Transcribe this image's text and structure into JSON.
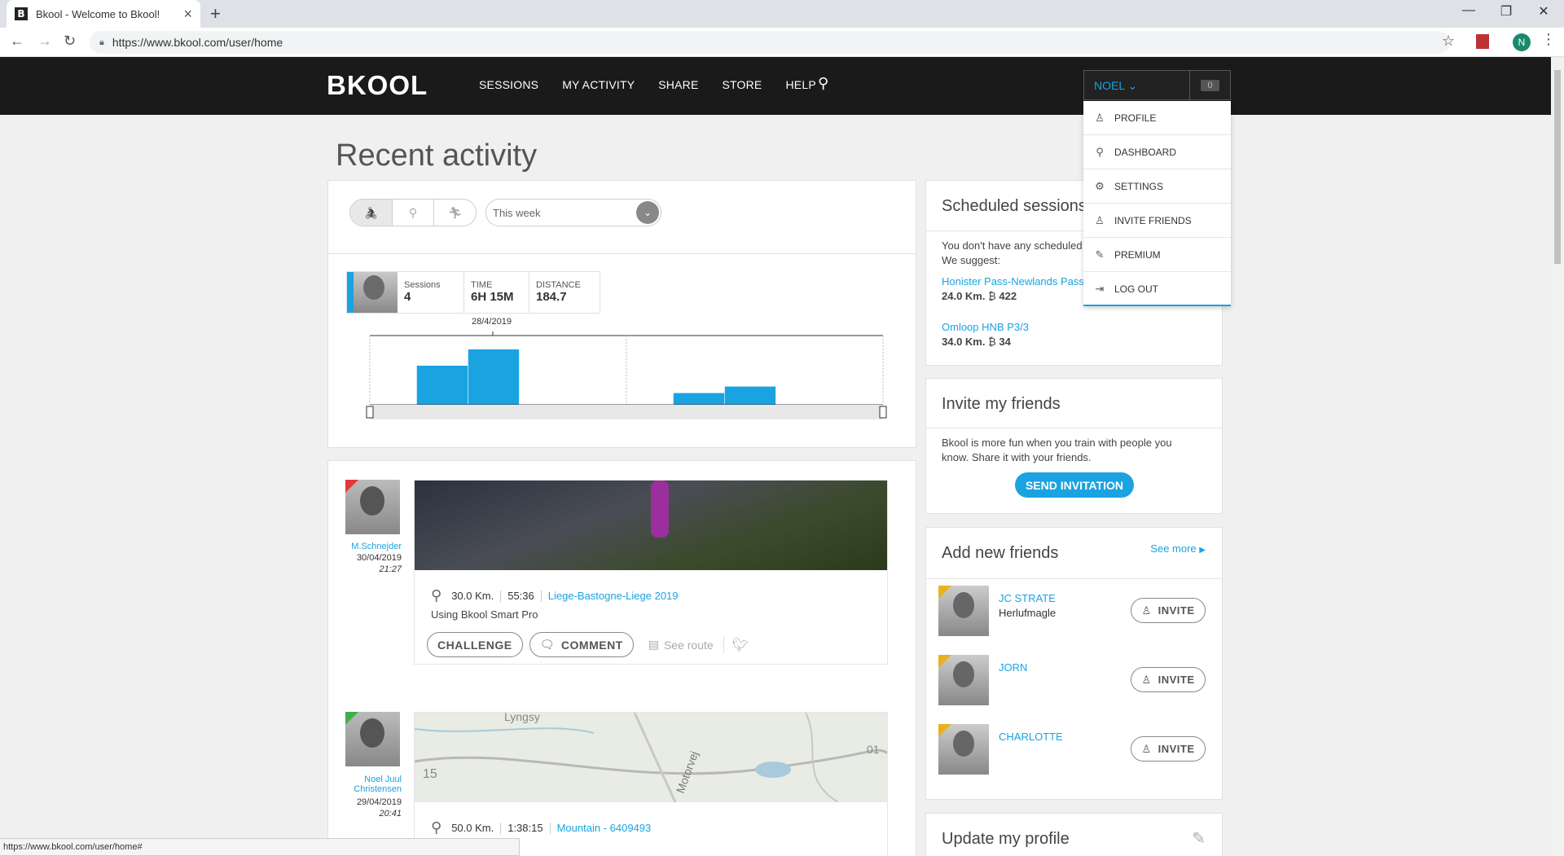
{
  "browser": {
    "tab_title": "Bkool - Welcome to Bkool!",
    "url": "https://www.bkool.com/user/home",
    "profile_initial": "N",
    "status_url": "https://www.bkool.com/user/home#"
  },
  "header": {
    "logo": "BKOOL",
    "nav": [
      "SESSIONS",
      "MY ACTIVITY",
      "SHARE",
      "STORE",
      "HELP"
    ],
    "user_name": "NOEL",
    "notifications": "0"
  },
  "user_menu": {
    "items": [
      {
        "label": "PROFILE",
        "icon": "person-icon"
      },
      {
        "label": "DASHBOARD",
        "icon": "bike-icon"
      },
      {
        "label": "SETTINGS",
        "icon": "gear-icon"
      },
      {
        "label": "INVITE FRIENDS",
        "icon": "add-person-icon"
      },
      {
        "label": "PREMIUM",
        "icon": "edit-icon"
      },
      {
        "label": "LOG OUT",
        "icon": "logout-icon"
      }
    ]
  },
  "activity": {
    "title": "Recent activity",
    "period": "This week",
    "stats": {
      "sessions_label": "Sessions",
      "sessions_value": "4",
      "time_label": "TIME",
      "time_value": "6H 15M",
      "distance_label": "DISTANCE",
      "distance_value": "184.7"
    },
    "chart_date": "28/4/2019"
  },
  "chart_data": {
    "type": "bar",
    "title": "",
    "annotations": [
      "28/4/2019"
    ],
    "values": [
      0,
      0.6,
      0.85,
      0,
      0,
      0,
      0.18,
      0.28,
      0
    ],
    "colors": {
      "bar": "#1aa3e0"
    }
  },
  "feed": [
    {
      "user": "M.Schnejder",
      "date": "30/04/2019",
      "time": "21:27",
      "distance": "30.0 Km.",
      "duration": "55:36",
      "route": "Liege-Bastogne-Liege 2019",
      "description": "Using Bkool Smart Pro",
      "challenge": "CHALLENGE",
      "comment": "COMMENT",
      "see_route": "See route"
    },
    {
      "user_line1": "Noel Juul",
      "user_line2": "Christensen",
      "date": "29/04/2019",
      "time": "20:41",
      "distance": "50.0 Km.",
      "duration": "1:38:15",
      "route": "Mountain - 6409493",
      "map_labels": [
        "Lyngsy",
        "15",
        "Motorvej",
        "01"
      ]
    }
  ],
  "scheduled": {
    "title": "Scheduled sessions",
    "line1": "You don't have any scheduled",
    "line2": "We suggest:",
    "suggestions": [
      {
        "name": "Honister Pass-Newlands Pass",
        "distance": "24.0 Km.",
        "coin": "₿",
        "points": "422"
      },
      {
        "name": "Omloop HNB P3/3",
        "distance": "34.0 Km.",
        "coin": "₿",
        "points": "34"
      }
    ]
  },
  "invite": {
    "title": "Invite my friends",
    "text1": "Bkool is more fun when you train with people you",
    "text2": "know. Share it with your friends.",
    "button": "SEND INVITATION"
  },
  "friends": {
    "title": "Add new friends",
    "see_more": "See more",
    "invite_label": "INVITE",
    "list": [
      {
        "name": "JC STRATE",
        "location": "Herlufmagle"
      },
      {
        "name": "JORN",
        "location": ""
      },
      {
        "name": "CHARLOTTE",
        "location": ""
      }
    ]
  },
  "profile": {
    "title": "Update my profile"
  }
}
